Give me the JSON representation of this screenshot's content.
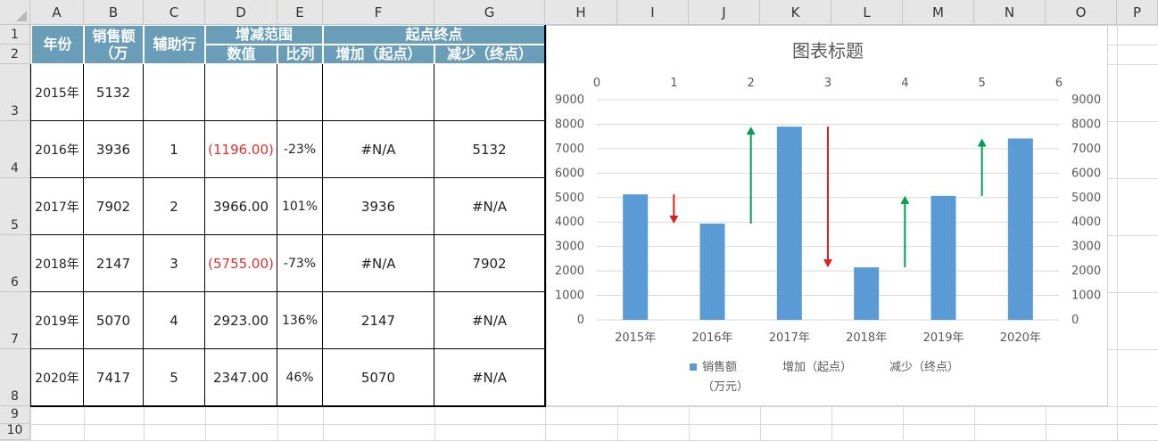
{
  "spreadsheet": {
    "columns": [
      "A",
      "B",
      "C",
      "D",
      "E",
      "F",
      "G",
      "H",
      "I",
      "J",
      "K",
      "L",
      "M",
      "N",
      "O",
      "P"
    ],
    "rows": [
      "1",
      "2",
      "3",
      "4",
      "5",
      "6",
      "7",
      "8",
      "9",
      "10"
    ],
    "header": {
      "year": "年份",
      "sales": "销售额（万",
      "aux": "辅助行",
      "range": "增减范围",
      "value": "数值",
      "ratio": "比列",
      "startend": "起点终点",
      "inc": "增加（起点）",
      "dec": "减少（终点）"
    },
    "data": [
      {
        "year": "2015年",
        "sales": "5132",
        "aux": "",
        "value": "",
        "ratio": "",
        "inc": "",
        "dec": ""
      },
      {
        "year": "2016年",
        "sales": "3936",
        "aux": "1",
        "value": "(1196.00)",
        "ratio": "-23%",
        "inc": "#N/A",
        "dec": "5132"
      },
      {
        "year": "2017年",
        "sales": "7902",
        "aux": "2",
        "value": "3966.00",
        "ratio": "101%",
        "inc": "3936",
        "dec": "#N/A"
      },
      {
        "year": "2018年",
        "sales": "2147",
        "aux": "3",
        "value": "(5755.00)",
        "ratio": "-73%",
        "inc": "#N/A",
        "dec": "7902"
      },
      {
        "year": "2019年",
        "sales": "5070",
        "aux": "4",
        "value": "2923.00",
        "ratio": "136%",
        "inc": "2147",
        "dec": "#N/A"
      },
      {
        "year": "2020年",
        "sales": "7417",
        "aux": "5",
        "value": "2347.00",
        "ratio": "46%",
        "inc": "5070",
        "dec": "#N/A"
      }
    ]
  },
  "chart_data": {
    "type": "bar",
    "title": "图表标题",
    "categories": [
      "2015年",
      "2016年",
      "2017年",
      "2018年",
      "2019年",
      "2020年"
    ],
    "series": [
      {
        "name": "销售额（万元）",
        "values": [
          5132,
          3936,
          7902,
          2147,
          5070,
          7417
        ],
        "color": "#5b9bd5"
      }
    ],
    "arrows": [
      {
        "x": 1,
        "from": 5132,
        "to": 3936,
        "color": "#e02020"
      },
      {
        "x": 2,
        "from": 3936,
        "to": 7902,
        "color": "#00a050"
      },
      {
        "x": 3,
        "from": 7902,
        "to": 2147,
        "color": "#e02020"
      },
      {
        "x": 4,
        "from": 2147,
        "to": 5070,
        "color": "#00a050"
      },
      {
        "x": 5,
        "from": 5070,
        "to": 7417,
        "color": "#00a050"
      }
    ],
    "legend": [
      "销售额",
      "（万元）",
      "增加（起点）",
      "减少（终点）"
    ],
    "ylim": [
      0,
      9000
    ],
    "yticks": [
      "0",
      "1000",
      "2000",
      "3000",
      "4000",
      "5000",
      "6000",
      "7000",
      "8000",
      "9000"
    ],
    "x2ticks": [
      "0",
      "1",
      "2",
      "3",
      "4",
      "5",
      "6"
    ],
    "x2lim": [
      0,
      6
    ],
    "legend_position": "bottom",
    "grid": true
  }
}
